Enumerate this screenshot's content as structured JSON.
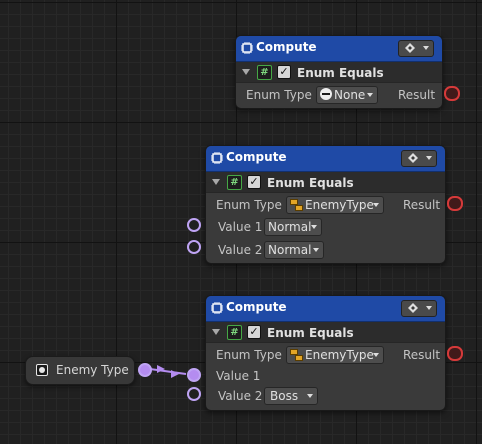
{
  "colors": {
    "header": "#1f4aa6",
    "body": "#3a3a3a",
    "value_port": "#b48cf0",
    "result_port": "#d63a3a",
    "grid_background": "#202020"
  },
  "nodes": [
    {
      "title": "Compute",
      "subtitle": "Enum Equals",
      "enum_type_label": "Enum Type",
      "enum_type_value": "None",
      "enum_type_icon": "none-circle-icon",
      "result_label": "Result"
    },
    {
      "title": "Compute",
      "subtitle": "Enum Equals",
      "enum_type_label": "Enum Type",
      "enum_type_value": "EnemyType",
      "enum_type_icon": "enum-type-icon",
      "result_label": "Result",
      "value1_label": "Value 1",
      "value1": "Normal",
      "value2_label": "Value 2",
      "value2": "Normal"
    },
    {
      "title": "Compute",
      "subtitle": "Enum Equals",
      "enum_type_label": "Enum Type",
      "enum_type_value": "EnemyType",
      "enum_type_icon": "enum-type-icon",
      "result_label": "Result",
      "value1_label": "Value 1",
      "value2_label": "Value 2",
      "value2": "Boss"
    }
  ],
  "variable_node": {
    "label": "Enemy Type",
    "icon": "variable-icon"
  }
}
